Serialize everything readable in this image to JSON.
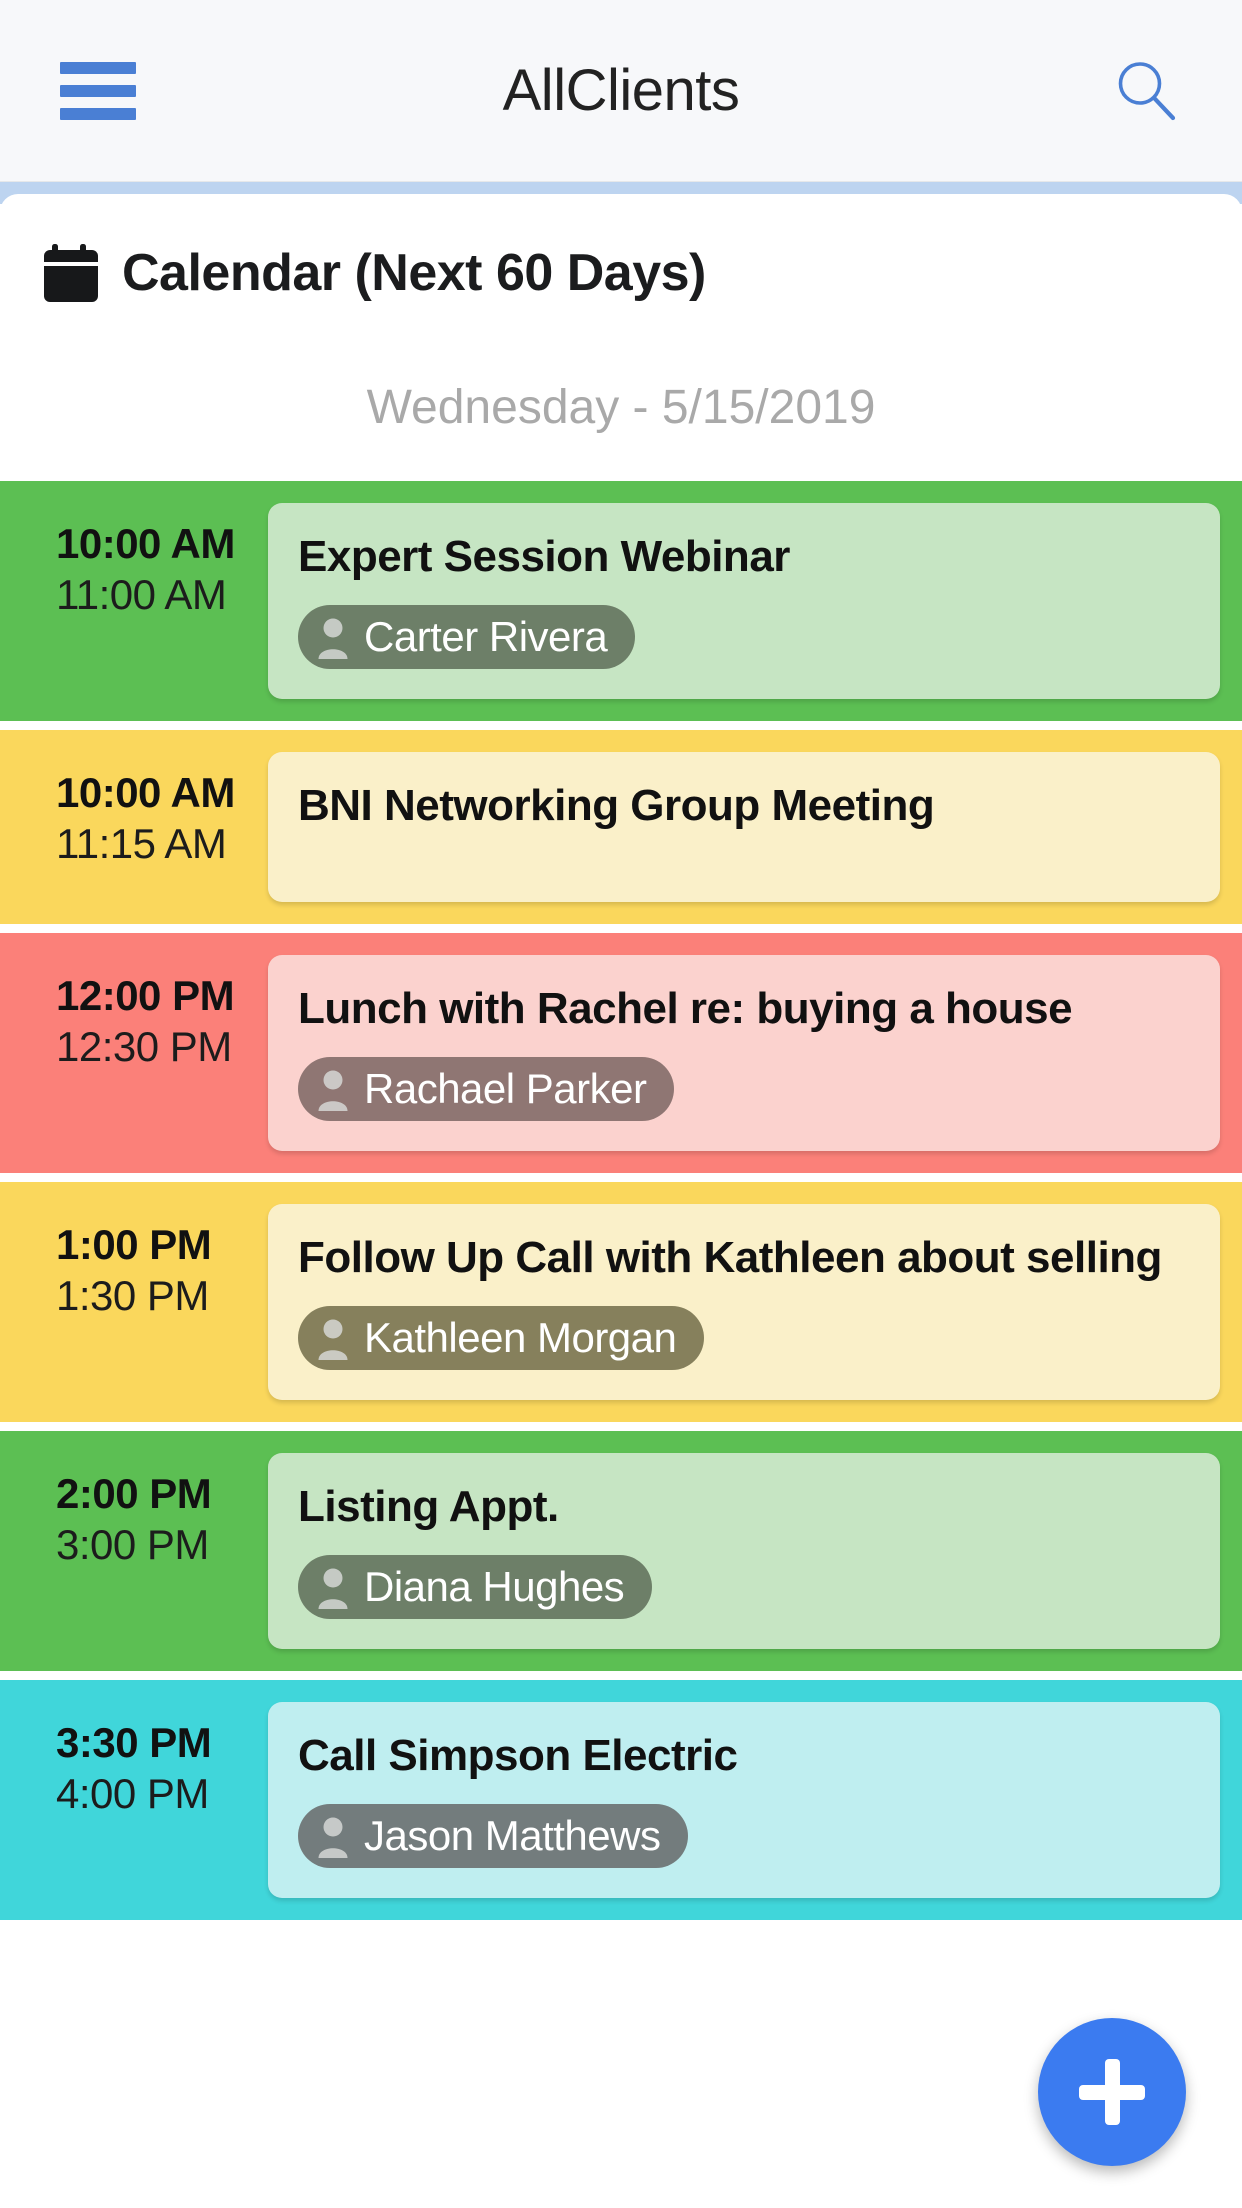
{
  "appbar": {
    "menu_icon": "hamburger-menu-icon",
    "title": "AllClients",
    "search_icon": "search-icon",
    "accent_color": "#4a7fd4"
  },
  "section": {
    "icon": "calendar-icon",
    "title": "Calendar (Next 60 Days)"
  },
  "date_header": "Wednesday - 5/15/2019",
  "fab": {
    "icon": "plus-icon",
    "label": "+",
    "color": "#3b7bf0"
  },
  "events": [
    {
      "start": "10:00 AM",
      "end": "11:00 AM",
      "title": "Expert Session Webinar",
      "contact": "Carter Rivera",
      "contact_icon": "person-icon",
      "row_color": "#5cbf53",
      "card_color": "#c6e5c3",
      "chip_color": "#6d7f68"
    },
    {
      "start": "10:00 AM",
      "end": "11:15 AM",
      "title": "BNI Networking Group Meeting",
      "contact": null,
      "contact_icon": "person-icon",
      "row_color": "#fad75c",
      "card_color": "#faf0c9",
      "chip_color": "#86805c"
    },
    {
      "start": "12:00 PM",
      "end": "12:30 PM",
      "title": "Lunch with Rachel re: buying a house",
      "contact": "Rachael Parker",
      "contact_icon": "person-icon",
      "row_color": "#fb8079",
      "card_color": "#fbd2ce",
      "chip_color": "#8f7673"
    },
    {
      "start": "1:00 PM",
      "end": "1:30 PM",
      "title": "Follow Up Call with Kathleen about selling",
      "contact": "Kathleen Morgan",
      "contact_icon": "person-icon",
      "row_color": "#fad75c",
      "card_color": "#faf0c9",
      "chip_color": "#86805c"
    },
    {
      "start": "2:00 PM",
      "end": "3:00 PM",
      "title": "Listing Appt.",
      "contact": "Diana Hughes",
      "contact_icon": "person-icon",
      "row_color": "#5cbf53",
      "card_color": "#c6e5c3",
      "chip_color": "#6d7f68"
    },
    {
      "start": "3:30 PM",
      "end": "4:00 PM",
      "title": "Call Simpson Electric",
      "contact": "Jason Matthews",
      "contact_icon": "person-icon",
      "row_color": "#40d6da",
      "card_color": "#bfeef0",
      "chip_color": "#737c7d"
    }
  ]
}
